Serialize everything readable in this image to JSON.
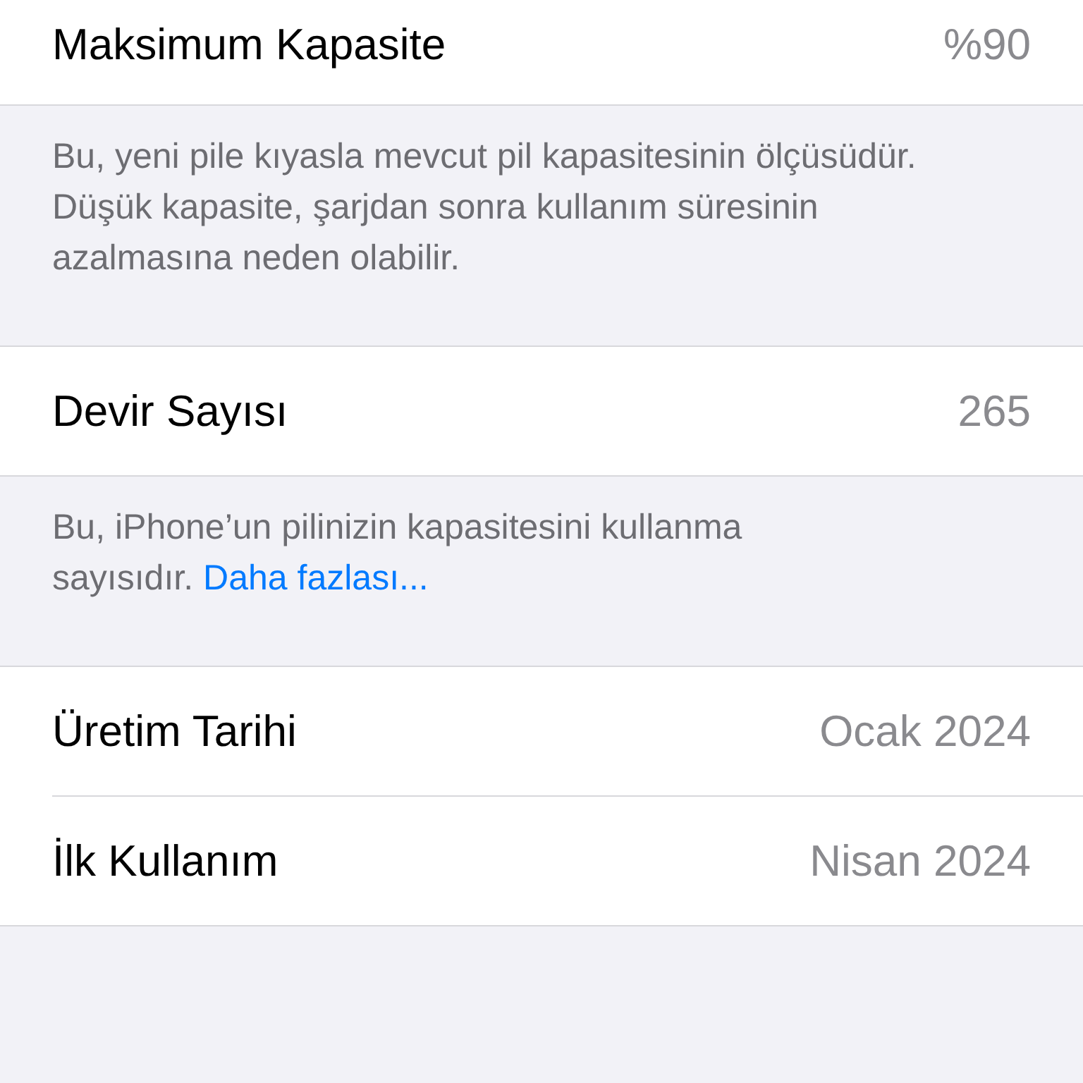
{
  "sections": [
    {
      "rows": [
        {
          "label": "Maksimum Kapasite",
          "value": "%90"
        }
      ],
      "footer": {
        "text": "Bu, yeni pile kıyasla mevcut pil kapasitesinin ölçüsüdür. Düşük kapasite, şarjdan sonra kullanım süresinin azalmasına neden olabilir."
      }
    },
    {
      "rows": [
        {
          "label": "Devir Sayısı",
          "value": "265"
        }
      ],
      "footer": {
        "text": "Bu, iPhone’un pilinizin kapasitesini kullanma sayısıdır.",
        "link": "Daha fazlası..."
      }
    },
    {
      "rows": [
        {
          "label": "Üretim Tarihi",
          "value": "Ocak 2024"
        },
        {
          "label": "İlk Kullanım",
          "value": "Nisan 2024"
        }
      ]
    }
  ]
}
